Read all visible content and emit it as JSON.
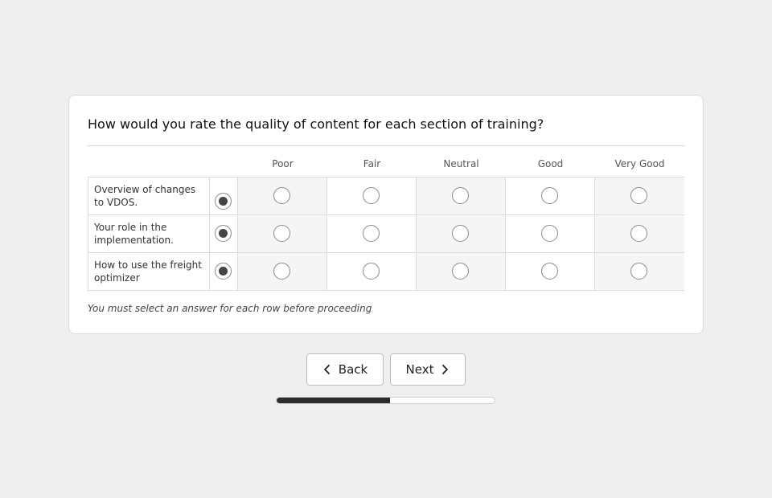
{
  "survey": {
    "question": "How would you rate the quality of content for each section of training?",
    "columns": [
      "Poor",
      "Fair",
      "Neutral",
      "Good",
      "Very Good"
    ],
    "rows": [
      {
        "label": "Overview of changes to VDOS.",
        "selected": null
      },
      {
        "label": "Your role in the implementation.",
        "selected": null
      },
      {
        "label": "How to use the freight optimizer",
        "selected": null
      }
    ],
    "validation_note": "You must select an answer for each row before proceeding"
  },
  "navigation": {
    "back_label": "Back",
    "next_label": "Next"
  },
  "progress": {
    "fraction": 0.52
  },
  "colors": {
    "page_background": "#efefef",
    "progress_fill": "#2b2b2b",
    "radio_checked": "#444444"
  }
}
